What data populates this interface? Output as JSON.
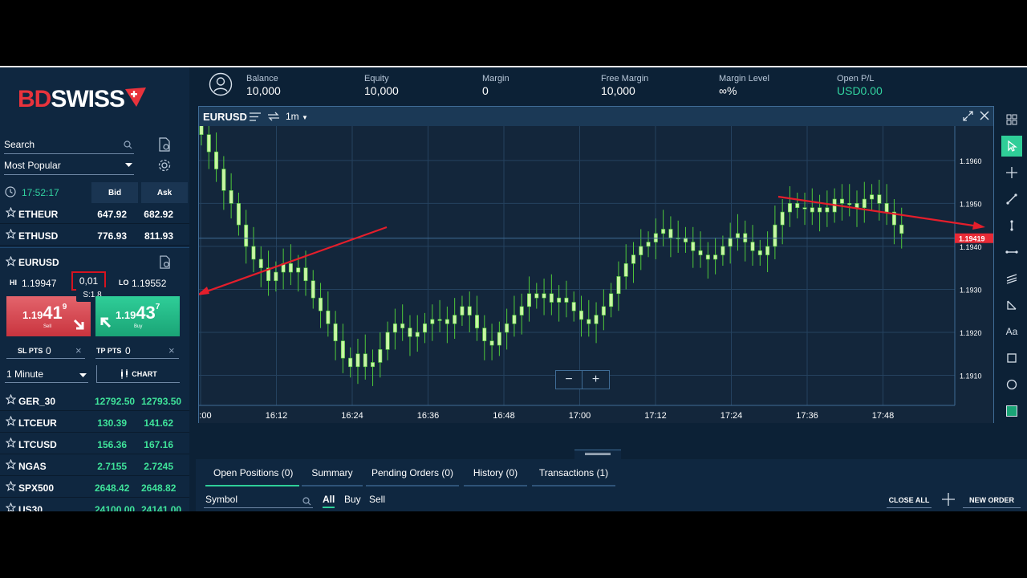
{
  "brand": {
    "part1": "BD",
    "part2": "SWISS"
  },
  "sidebar": {
    "search_label": "Search",
    "filter_label": "Most Popular",
    "time": "17:52:17",
    "bid_header": "Bid",
    "ask_header": "Ask",
    "top_rows": [
      {
        "symbol": "ETHEUR",
        "bid": "647.92",
        "ask": "682.92"
      },
      {
        "symbol": "ETHUSD",
        "bid": "776.93",
        "ask": "811.93"
      }
    ],
    "selected": {
      "symbol": "EURUSD",
      "hi_label": "HI",
      "hi": "1.19947",
      "lot": "0,01",
      "lo_label": "LO",
      "lo": "1.19552",
      "spread": "S:1.8",
      "sell": {
        "small": "1.19",
        "large": "41",
        "sup": "9",
        "label": "Sell"
      },
      "buy": {
        "small": "1.19",
        "large": "43",
        "sup": "7",
        "label": "Buy"
      },
      "sl_label": "SL PTS",
      "sl_value": "0",
      "tp_label": "TP PTS",
      "tp_value": "0",
      "timeframe": "1 Minute",
      "chart_button": "CHART"
    },
    "rows": [
      {
        "symbol": "GER_30",
        "bid": "12792.50",
        "ask": "12793.50"
      },
      {
        "symbol": "LTCEUR",
        "bid": "130.39",
        "ask": "141.62"
      },
      {
        "symbol": "LTCUSD",
        "bid": "156.36",
        "ask": "167.16"
      },
      {
        "symbol": "NGAS",
        "bid": "2.7155",
        "ask": "2.7245"
      },
      {
        "symbol": "SPX500",
        "bid": "2648.42",
        "ask": "2648.82"
      },
      {
        "symbol": "US30",
        "bid": "24100.00",
        "ask": "24141.00"
      }
    ]
  },
  "account": {
    "balance_label": "Balance",
    "balance": "10,000",
    "equity_label": "Equity",
    "equity": "10,000",
    "margin_label": "Margin",
    "margin": "0",
    "free_margin_label": "Free Margin",
    "free_margin": "10,000",
    "margin_level_label": "Margin Level",
    "margin_level": "∞%",
    "open_pl_label": "Open P/L",
    "open_pl": "USD0.00"
  },
  "chart": {
    "symbol": "EURUSD",
    "timeframe": "1m",
    "current_price": "1.19419"
  },
  "chart_data": {
    "type": "candlestick",
    "x_ticks": [
      ":00",
      "16:12",
      "16:24",
      "16:36",
      "16:48",
      "17:00",
      "17:12",
      "17:24",
      "17:36",
      "17:48"
    ],
    "y_ticks": [
      "1.1960",
      "1.1950",
      "1.1940",
      "1.1930",
      "1.1920",
      "1.1910"
    ],
    "y_tick_values": [
      1.196,
      1.195,
      1.194,
      1.193,
      1.192,
      1.191
    ],
    "ylim": [
      1.1903,
      1.1968
    ],
    "current_price": 1.19419,
    "grid": true,
    "up_color": "#c8f5a4",
    "down_color": "#c8f5a4",
    "wick_color": "#4fc93a",
    "close_path": [
      1.1966,
      1.1962,
      1.1958,
      1.1953,
      1.195,
      1.1945,
      1.194,
      1.1937,
      1.1935,
      1.1932,
      1.1934,
      1.1936,
      1.1934,
      1.1935,
      1.1932,
      1.1928,
      1.1925,
      1.1922,
      1.1918,
      1.1914,
      1.1912,
      1.1915,
      1.1912,
      1.1913,
      1.1916,
      1.192,
      1.1922,
      1.1921,
      1.1919,
      1.192,
      1.1922,
      1.1923,
      1.1923,
      1.1922,
      1.1924,
      1.1926,
      1.1924,
      1.1921,
      1.1918,
      1.1917,
      1.192,
      1.1922,
      1.1924,
      1.1926,
      1.1929,
      1.1928,
      1.1929,
      1.1927,
      1.1928,
      1.1927,
      1.1925,
      1.1923,
      1.1922,
      1.1924,
      1.1926,
      1.1929,
      1.1933,
      1.1936,
      1.1938,
      1.194,
      1.1941,
      1.1943,
      1.1944,
      1.1942,
      1.1942,
      1.1941,
      1.1939,
      1.1938,
      1.1937,
      1.1938,
      1.194,
      1.1942,
      1.1943,
      1.1941,
      1.1939,
      1.1938,
      1.194,
      1.1945,
      1.1948,
      1.195,
      1.1949,
      1.1949,
      1.1948,
      1.1949,
      1.1948,
      1.1951,
      1.195,
      1.195,
      1.1949,
      1.1951,
      1.1952,
      1.195,
      1.1948,
      1.1945,
      1.1943
    ]
  },
  "annotations": {
    "red_arrows": 2
  },
  "bottom": {
    "tabs": [
      "Open Positions (0)",
      "Summary",
      "Pending Orders (0)",
      "History (0)",
      "Transactions (1)"
    ],
    "symbol_placeholder": "Symbol",
    "filters": [
      "All",
      "Buy",
      "Sell"
    ],
    "close_all": "CLOSE ALL",
    "new_order": "NEW ORDER"
  },
  "colors": {
    "accent": "#2fce98",
    "sell": "#d0434c",
    "buy": "#23b583",
    "brand_red": "#e8333c",
    "price_tag": "#e82a36"
  }
}
